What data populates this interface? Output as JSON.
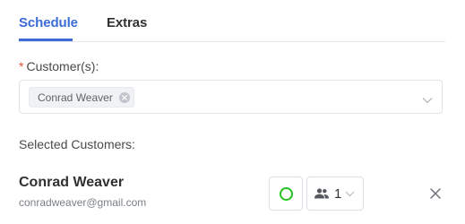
{
  "tabs": [
    {
      "label": "Schedule",
      "active": true
    },
    {
      "label": "Extras",
      "active": false
    }
  ],
  "customers_field": {
    "required_mark": "*",
    "label": "Customer(s):",
    "selected_tags": [
      "Conrad Weaver"
    ]
  },
  "selected_section": {
    "label": "Selected Customers:"
  },
  "selected_customers": [
    {
      "name": "Conrad Weaver",
      "email": "conradweaver@gmail.com",
      "status_color": "#22c31f",
      "persons": "1"
    }
  ],
  "colors": {
    "accent": "#3a6bd6",
    "required": "#e74c3c",
    "status_approved": "#22c31f"
  },
  "icons": {
    "tag_remove": "close-circle-icon",
    "dropdown": "chevron-down-icon",
    "persons": "people-icon",
    "remove_customer": "close-icon"
  }
}
